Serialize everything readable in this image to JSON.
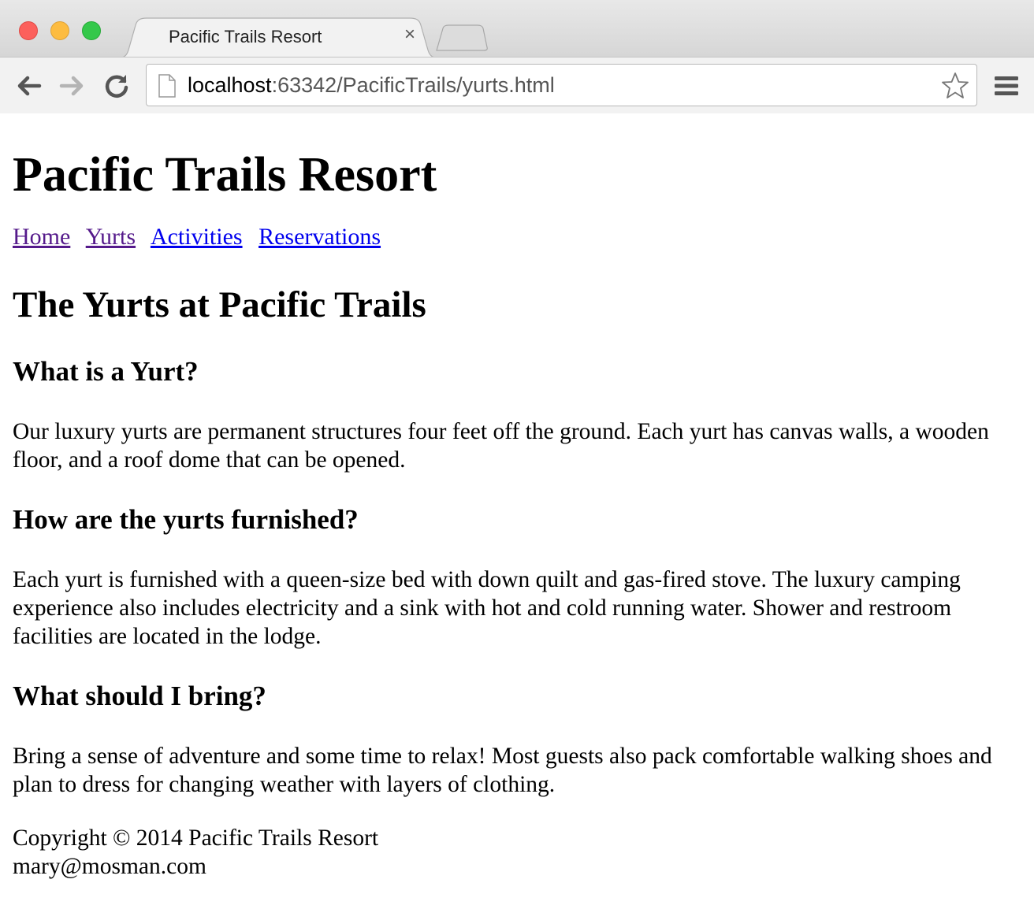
{
  "browser": {
    "tab_title": "Pacific Trails Resort",
    "url_host": "localhost",
    "url_rest": ":63342/PacificTrails/yurts.html"
  },
  "page": {
    "site_title": "Pacific Trails Resort",
    "nav": [
      "Home",
      "Yurts",
      "Activities",
      "Reservations"
    ],
    "heading": "The Yurts at Pacific Trails",
    "sections": [
      {
        "question": "What is a Yurt?",
        "answer": "Our luxury yurts are permanent structures four feet off the ground. Each yurt has canvas walls, a wooden floor, and a roof dome that can be opened."
      },
      {
        "question": "How are the yurts furnished?",
        "answer": "Each yurt is furnished with a queen-size bed with down quilt and gas-fired stove. The luxury camping experience also includes electricity and a sink with hot and cold running water. Shower and restroom facilities are located in the lodge."
      },
      {
        "question": "What should I bring?",
        "answer": "Bring a sense of adventure and some time to relax! Most guests also pack comfortable walking shoes and plan to dress for changing weather with layers of clothing."
      }
    ],
    "footer": {
      "copyright": "Copyright © 2014 Pacific Trails Resort",
      "email": "mary@mosman.com"
    }
  },
  "colors": {
    "link": "#0000ee",
    "visited_link": "#551a8b"
  }
}
